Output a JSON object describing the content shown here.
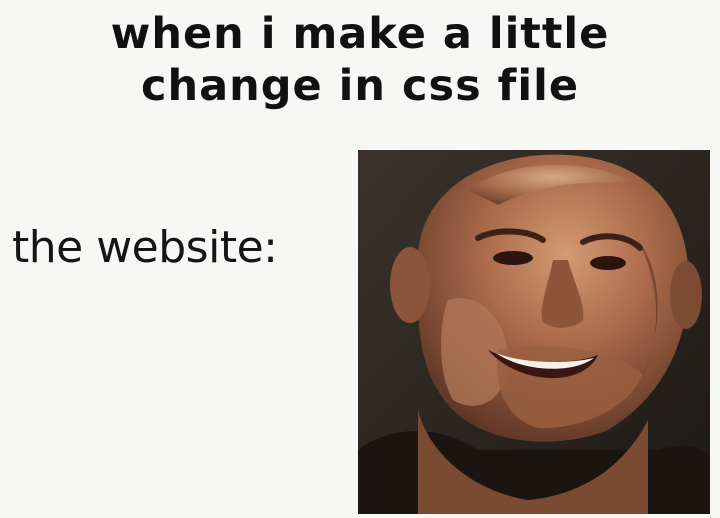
{
  "caption": {
    "line1": "when i make a little",
    "line2": "change in css file"
  },
  "label": "the website:",
  "image": {
    "subject": "distorted-smiling-face-photo",
    "background_color": "#2a2420",
    "skin_color": "#a0684a"
  }
}
